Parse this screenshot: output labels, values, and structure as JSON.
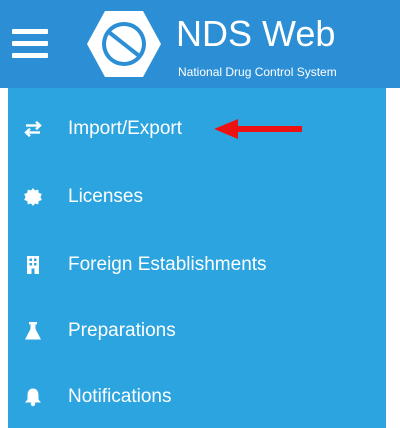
{
  "header": {
    "title": "NDS Web",
    "subtitle": "National Drug Control System",
    "menu_icon": "hamburger-menu-icon",
    "logo_icon": "pill-hexagon-logo"
  },
  "colors": {
    "header_background": "#2c8fd6",
    "sidebar_background": "#2ba4e0",
    "text": "#ffffff",
    "annotation_arrow": "#ee1111"
  },
  "sidebar": {
    "items": [
      {
        "label": "Import/Export",
        "icon": "swap-arrows-icon"
      },
      {
        "label": "Licenses",
        "icon": "seal-badge-icon"
      },
      {
        "label": "Foreign Establishments",
        "icon": "building-icon"
      },
      {
        "label": "Preparations",
        "icon": "flask-icon"
      },
      {
        "label": "Notifications",
        "icon": "bell-icon"
      }
    ]
  },
  "annotation": {
    "type": "red-arrow",
    "points_to": "Import/Export"
  }
}
